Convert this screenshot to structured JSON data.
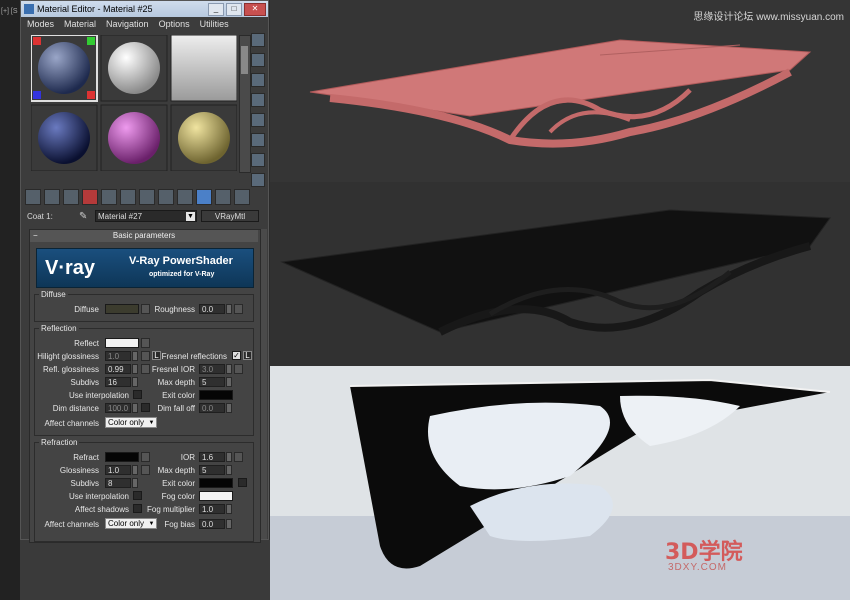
{
  "window": {
    "title": "Material Editor - Material #25",
    "min": "_",
    "max": "□",
    "close": "✕"
  },
  "menu": [
    "Modes",
    "Material",
    "Navigation",
    "Options",
    "Utilities"
  ],
  "left_strip": "[+] [S",
  "slots": [
    {
      "name": "checker",
      "color": "#4a5a7a"
    },
    {
      "name": "white",
      "color": "#e8e8e8"
    },
    {
      "name": "grey-flat",
      "color": "#c8c8c8"
    },
    {
      "name": "blue",
      "color": "#2a3a7a"
    },
    {
      "name": "pink",
      "color": "#c060c0"
    },
    {
      "name": "yellow",
      "color": "#c9b86a"
    }
  ],
  "coat": {
    "label": "Coat 1:",
    "material": "Material #27",
    "type": "VRayMtl"
  },
  "panel": {
    "header": "Basic parameters",
    "vray": {
      "logo": "V·ray",
      "title": "V-Ray PowerShader",
      "subtitle": "optimized for V-Ray"
    },
    "diffuse": {
      "group": "Diffuse",
      "diffuse": "Diffuse",
      "roughness": "Roughness",
      "roughness_val": "0.0",
      "color": "#3c3c2e"
    },
    "reflection": {
      "group": "Reflection",
      "reflect": "Reflect",
      "reflect_color": "#f2f2f2",
      "hilight": "Hilight glossiness",
      "hilight_val": "1.0",
      "L": "L",
      "fresnel": "Fresnel reflections",
      "fresnel_checked": "✓",
      "refl_gloss": "Refl. glossiness",
      "refl_gloss_val": "0.99",
      "fresnel_ior": "Fresnel IOR",
      "fresnel_ior_val": "3.0",
      "subdivs": "Subdivs",
      "subdivs_val": "16",
      "max_depth": "Max depth",
      "max_depth_val": "5",
      "use_interp": "Use interpolation",
      "exit_color": "Exit color",
      "dim_distance": "Dim distance",
      "dim_distance_val": "100.0",
      "dim_falloff": "Dim fall off",
      "dim_falloff_val": "0.0",
      "affect": "Affect channels",
      "affect_val": "Color only"
    },
    "refraction": {
      "group": "Refraction",
      "refract": "Refract",
      "refract_color": "#050505",
      "ior": "IOR",
      "ior_val": "1.6",
      "glossiness": "Glossiness",
      "glossiness_val": "1.0",
      "max_depth": "Max depth",
      "max_depth_val": "5",
      "subdivs": "Subdivs",
      "subdivs_val": "8",
      "exit_color": "Exit color",
      "use_interp": "Use interpolation",
      "fog_color": "Fog color",
      "fog_color_val": "#f5f5f5",
      "affect_shadows": "Affect shadows",
      "fog_mult": "Fog multiplier",
      "fog_mult_val": "1.0",
      "affect": "Affect channels",
      "affect_val": "Color only",
      "fog_bias": "Fog bias",
      "fog_bias_val": "0.0"
    }
  },
  "watermark": "思缘设计论坛 www.missyuan.com",
  "logo": {
    "main": "3D学院",
    "sub": "3DXY.COM"
  }
}
